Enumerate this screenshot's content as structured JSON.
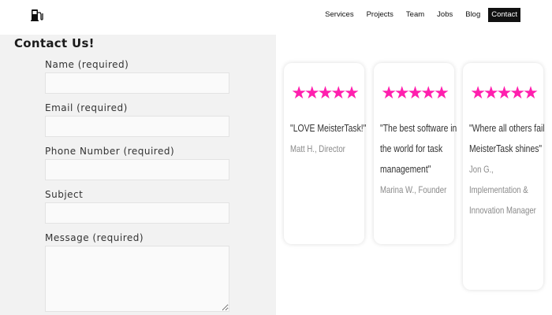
{
  "header": {
    "logo_icon": "fuel-pump-icon",
    "nav": [
      {
        "label": "Services"
      },
      {
        "label": "Projects"
      },
      {
        "label": "Team"
      },
      {
        "label": "Jobs"
      },
      {
        "label": "Blog"
      },
      {
        "label": "Contact",
        "active": true
      }
    ]
  },
  "form": {
    "title": "Contact Us!",
    "fields": [
      {
        "label": "Name (required)",
        "value": ""
      },
      {
        "label": "Email (required)",
        "value": ""
      },
      {
        "label": "Phone Number (required)",
        "value": ""
      },
      {
        "label": "Subject",
        "value": ""
      },
      {
        "label": "Message (required)",
        "value": ""
      }
    ]
  },
  "testimonials": [
    {
      "stars": 5,
      "quote": "\"LOVE MeisterTask!\"",
      "author": "Matt H., Director"
    },
    {
      "stars": 5,
      "quote": "\"The best software in the world for task management\"",
      "author": "Marina W., Founder"
    },
    {
      "stars": 5,
      "quote": "\"Where all others fail MeisterTask shines\"",
      "author": "Jon G., Implementation & Innovation Manager"
    }
  ],
  "colors": {
    "star": "#ff1fae",
    "panel_bg": "#f2f2f2",
    "active_nav_bg": "#111111"
  }
}
